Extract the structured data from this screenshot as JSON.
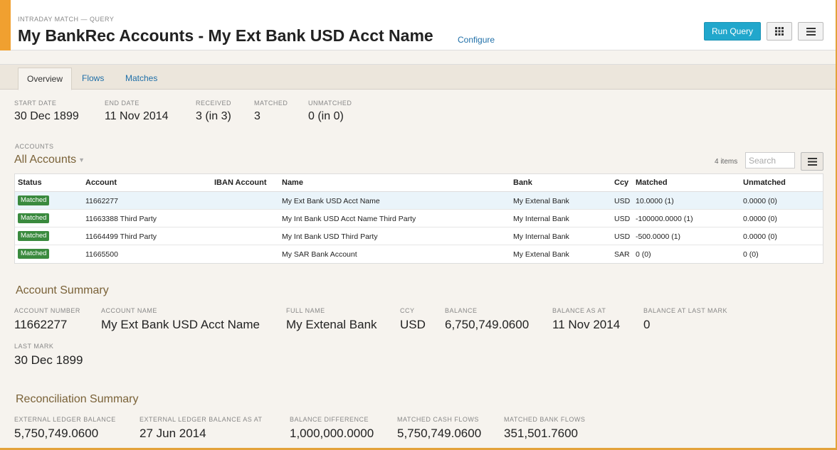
{
  "header": {
    "kicker": "INTRADAY MATCH — QUERY",
    "title": "My BankRec Accounts - My Ext Bank USD Acct Name",
    "configure_label": "Configure",
    "run_query_label": "Run Query"
  },
  "tabs": [
    {
      "label": "Overview",
      "active": true
    },
    {
      "label": "Flows",
      "active": false
    },
    {
      "label": "Matches",
      "active": false
    }
  ],
  "stats": {
    "start_date": {
      "label": "START DATE",
      "value": "30 Dec 1899"
    },
    "end_date": {
      "label": "END DATE",
      "value": "11 Nov 2014"
    },
    "received": {
      "label": "RECEIVED",
      "value": "3 (in 3)"
    },
    "matched": {
      "label": "MATCHED",
      "value": "3"
    },
    "unmatched": {
      "label": "UNMATCHED",
      "value": "0 (in 0)"
    }
  },
  "accounts": {
    "label": "ACCOUNTS",
    "selected": "All Accounts",
    "items_count": "4 items",
    "search_placeholder": "Search",
    "columns": [
      "Status",
      "Account",
      "IBAN Account",
      "Name",
      "Bank",
      "Ccy",
      "Matched",
      "Unmatched"
    ],
    "rows": [
      {
        "status": "Matched",
        "account": "11662277",
        "iban": "",
        "name": "My Ext Bank USD Acct Name",
        "bank": "My Extenal Bank",
        "ccy": "USD",
        "matched": "10.0000 (1)",
        "unmatched": "0.0000 (0)"
      },
      {
        "status": "Matched",
        "account": "11663388 Third Party",
        "iban": "",
        "name": "My Int Bank USD Acct Name Third Party",
        "bank": "My Internal Bank",
        "ccy": "USD",
        "matched": "-100000.0000 (1)",
        "unmatched": "0.0000 (0)"
      },
      {
        "status": "Matched",
        "account": "11664499 Third Party",
        "iban": "",
        "name": "My Int Bank USD Third Party",
        "bank": "My Internal Bank",
        "ccy": "USD",
        "matched": "-500.0000 (1)",
        "unmatched": "0.0000 (0)"
      },
      {
        "status": "Matched",
        "account": "11665500",
        "iban": "",
        "name": "My SAR Bank Account",
        "bank": "My Extenal Bank",
        "ccy": "SAR",
        "matched": "0 (0)",
        "unmatched": "0 (0)"
      }
    ]
  },
  "account_summary": {
    "title": "Account Summary",
    "account_number": {
      "label": "ACCOUNT NUMBER",
      "value": "11662277"
    },
    "account_name": {
      "label": "ACCOUNT NAME",
      "value": "My Ext Bank USD Acct Name"
    },
    "full_name": {
      "label": "FULL NAME",
      "value": "My Extenal Bank"
    },
    "ccy": {
      "label": "CCY",
      "value": "USD"
    },
    "balance": {
      "label": "BALANCE",
      "value": "6,750,749.0600"
    },
    "balance_as_at": {
      "label": "BALANCE AS AT",
      "value": "11 Nov 2014"
    },
    "balance_at_last_mark": {
      "label": "BALANCE AT LAST MARK",
      "value": "0"
    },
    "last_mark": {
      "label": "LAST MARK",
      "value": "30 Dec 1899"
    }
  },
  "reconciliation_summary": {
    "title": "Reconciliation Summary",
    "external_ledger_balance": {
      "label": "EXTERNAL LEDGER BALANCE",
      "value": "5,750,749.0600"
    },
    "external_ledger_balance_as_at": {
      "label": "EXTERNAL LEDGER BALANCE AS AT",
      "value": "27 Jun 2014"
    },
    "balance_difference": {
      "label": "BALANCE DIFFERENCE",
      "value": "1,000,000.0000"
    },
    "matched_cash_flows": {
      "label": "MATCHED CASH FLOWS",
      "value": "5,750,749.0600"
    },
    "matched_bank_flows": {
      "label": "MATCHED BANK FLOWS",
      "value": "351,501.7600"
    }
  },
  "colors": {
    "accent": "#f0a030",
    "primary_button": "#21a7cc",
    "matched_badge": "#3a8a3e",
    "section_title": "#7a6238",
    "link": "#1f6fa8"
  },
  "icons": {
    "grid_button": "grid-icon",
    "menu_button": "hamburger-icon",
    "list_button": "hamburger-icon",
    "accounts_dropdown": "caret-down-icon"
  }
}
